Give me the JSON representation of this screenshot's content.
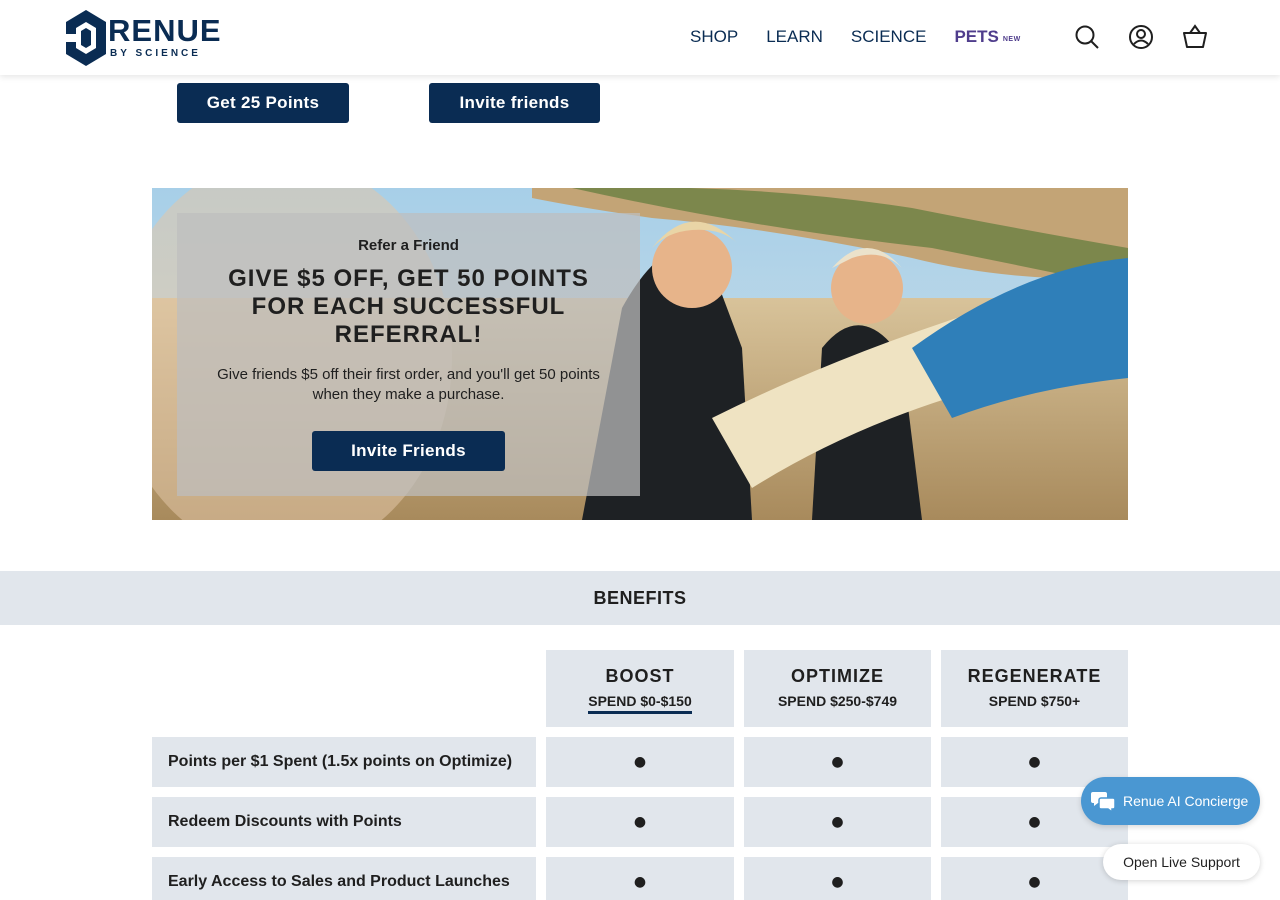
{
  "brand": {
    "name": "RENUE",
    "tagline": "BY SCIENCE"
  },
  "nav": {
    "items": [
      {
        "label": "SHOP"
      },
      {
        "label": "LEARN"
      },
      {
        "label": "SCIENCE"
      }
    ],
    "pets": {
      "label": "PETS",
      "badge": "NEW"
    }
  },
  "header_icons": [
    "search-icon",
    "account-icon",
    "cart-icon"
  ],
  "actions": {
    "get_points": "Get 25 Points",
    "invite": "Invite friends"
  },
  "hero": {
    "eyebrow": "Refer a Friend",
    "title": "GIVE $5 OFF, GET 50 POINTS FOR EACH SUCCESSFUL REFERRAL!",
    "body": "Give friends $5 off their first order, and you'll get 50 points when they make a purchase.",
    "button": "Invite Friends"
  },
  "benefits": {
    "title": "BENEFITS",
    "tiers": [
      {
        "name": "BOOST",
        "range": "SPEND $0-$150",
        "active": true
      },
      {
        "name": "OPTIMIZE",
        "range": "SPEND $250-$749",
        "active": false
      },
      {
        "name": "REGENERATE",
        "range": "SPEND $750+",
        "active": false
      }
    ],
    "rows": [
      {
        "label": "Points per $1 Spent (1.5x points on Optimize)",
        "cells": [
          "●",
          "●",
          "●"
        ]
      },
      {
        "label": "Redeem Discounts with Points",
        "cells": [
          "●",
          "●",
          "●"
        ]
      },
      {
        "label": "Early Access to Sales and Product Launches",
        "cells": [
          "●",
          "●",
          "●"
        ]
      }
    ]
  },
  "widgets": {
    "concierge": "Renue AI Concierge",
    "live_support": "Open Live Support"
  },
  "colors": {
    "navy": "#0a2c53",
    "purple": "#4f3d8c",
    "band": "#e1e6ec",
    "concierge": "#4a97d2"
  }
}
